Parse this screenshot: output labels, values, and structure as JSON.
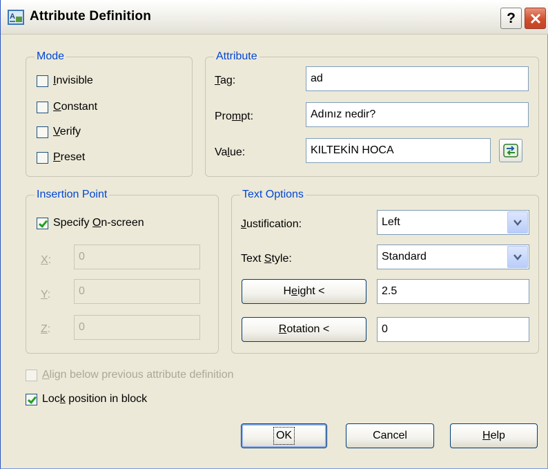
{
  "window": {
    "title": "Attribute Definition",
    "help_glyph": "?",
    "close_glyph": "✕"
  },
  "mode": {
    "title": "Mode",
    "invisible": {
      "pre": "",
      "key": "I",
      "post": "nvisible",
      "checked": false
    },
    "constant": {
      "pre": "",
      "key": "C",
      "post": "onstant",
      "checked": false
    },
    "verify": {
      "pre": "",
      "key": "V",
      "post": "erify",
      "checked": false
    },
    "preset": {
      "pre": "",
      "key": "P",
      "post": "reset",
      "checked": false
    }
  },
  "attribute": {
    "title": "Attribute",
    "tag": {
      "pre": "",
      "key": "T",
      "post": "ag:",
      "value": "ad"
    },
    "prompt": {
      "pre": "Pro",
      "key": "m",
      "post": "pt:",
      "value": "Adınız nedir?"
    },
    "value": {
      "pre": "Va",
      "key": "l",
      "post": "ue:",
      "value": "KILTEKİN HOCA"
    }
  },
  "insertion_point": {
    "title": "Insertion Point",
    "specify": {
      "pre": "Specify ",
      "key": "O",
      "post": "n-screen",
      "checked": true
    },
    "x": {
      "key": "X",
      "post": ":",
      "value": "0"
    },
    "y": {
      "key": "Y",
      "post": ":",
      "value": "0"
    },
    "z": {
      "key": "Z",
      "post": ":",
      "value": "0"
    }
  },
  "text_options": {
    "title": "Text Options",
    "justification": {
      "pre": "",
      "key": "J",
      "post": "ustification:",
      "value": "Left"
    },
    "text_style": {
      "pre": "Text ",
      "key": "S",
      "post": "tyle:",
      "value": "Standard"
    },
    "height": {
      "pre": "H",
      "key": "e",
      "post": "ight <",
      "value": "2.5"
    },
    "rotation": {
      "pre": "",
      "key": "R",
      "post": "otation <",
      "value": "0"
    }
  },
  "align_below": {
    "pre": "",
    "key": "A",
    "post": "lign below previous attribute definition",
    "checked": false,
    "enabled": false
  },
  "lock_position": {
    "pre": "Loc",
    "key": "k",
    "post": " position in block",
    "checked": true
  },
  "buttons": {
    "ok": "OK",
    "cancel": "Cancel",
    "help": {
      "key": "H",
      "post": "elp"
    }
  },
  "colors": {
    "group_title": "#0046d5",
    "dialog_bg": "#ece9d8",
    "check": "#21a121"
  }
}
